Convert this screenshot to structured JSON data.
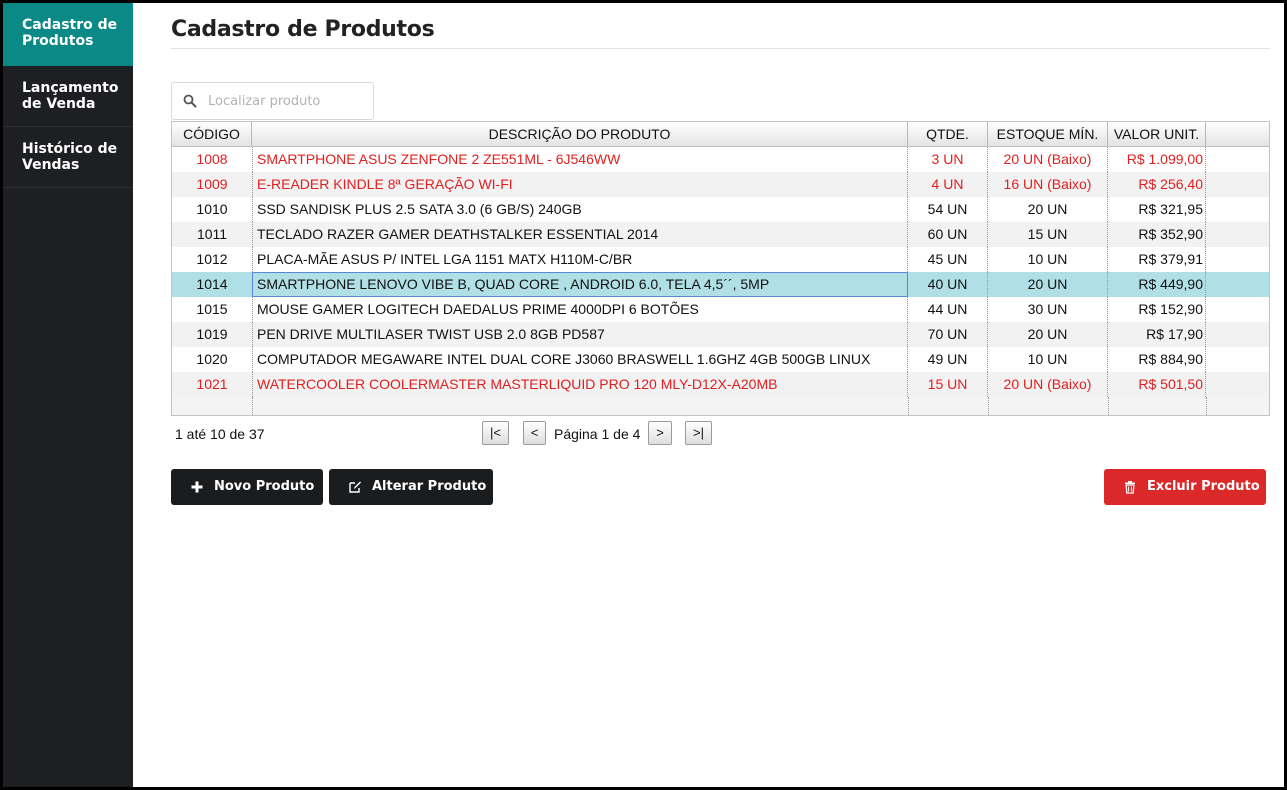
{
  "sidebar": {
    "items": [
      {
        "label_line1": "Cadastro de",
        "label_line2": "Produtos",
        "active": true
      },
      {
        "label_line1": "Lançamento",
        "label_line2": "de Venda",
        "active": false
      },
      {
        "label_line1": "Histórico de",
        "label_line2": "Vendas",
        "active": false
      }
    ]
  },
  "page": {
    "title": "Cadastro de Produtos"
  },
  "search": {
    "placeholder": "Localizar produto",
    "value": ""
  },
  "table": {
    "headers": [
      "CÓDIGO",
      "DESCRIÇÃO DO PRODUTO",
      "QTDE.",
      "ESTOQUE MÍN.",
      "VALOR UNIT."
    ],
    "rows": [
      {
        "code": "1008",
        "desc": "SMARTPHONE ASUS ZENFONE 2 ZE551ML - 6J546WW",
        "qty": "3 UN",
        "min": "20 UN (Baixo)",
        "value": "R$ 1.099,00",
        "low": true
      },
      {
        "code": "1009",
        "desc": "E-READER KINDLE 8ª GERAÇÃO WI-FI",
        "qty": "4 UN",
        "min": "16 UN (Baixo)",
        "value": "R$ 256,40",
        "low": true
      },
      {
        "code": "1010",
        "desc": "SSD SANDISK PLUS 2.5 SATA 3.0 (6 GB/S) 240GB",
        "qty": "54 UN",
        "min": "20 UN",
        "value": "R$ 321,95",
        "low": false
      },
      {
        "code": "1011",
        "desc": "TECLADO RAZER GAMER DEATHSTALKER ESSENTIAL 2014",
        "qty": "60 UN",
        "min": "15 UN",
        "value": "R$ 352,90",
        "low": false
      },
      {
        "code": "1012",
        "desc": "PLACA-MÃE ASUS P/ INTEL LGA 1151 MATX H110M-C/BR",
        "qty": "45 UN",
        "min": "10 UN",
        "value": "R$ 379,91",
        "low": false
      },
      {
        "code": "1014",
        "desc": "SMARTPHONE LENOVO VIBE B, QUAD CORE , ANDROID 6.0, TELA 4,5´´, 5MP",
        "qty": "40 UN",
        "min": "20 UN",
        "value": "R$ 449,90",
        "low": false,
        "selected": true
      },
      {
        "code": "1015",
        "desc": "MOUSE GAMER LOGITECH DAEDALUS PRIME 4000DPI 6 BOTÕES",
        "qty": "44 UN",
        "min": "30 UN",
        "value": "R$ 152,90",
        "low": false
      },
      {
        "code": "1019",
        "desc": "PEN DRIVE MULTILASER TWIST USB 2.0 8GB PD587",
        "qty": "70 UN",
        "min": "20 UN",
        "value": "R$ 17,90",
        "low": false
      },
      {
        "code": "1020",
        "desc": "COMPUTADOR MEGAWARE INTEL DUAL CORE J3060 BRASWELL 1.6GHZ 4GB 500GB LINUX",
        "qty": "49 UN",
        "min": "10 UN",
        "value": "R$ 884,90",
        "low": false
      },
      {
        "code": "1021",
        "desc": "WATERCOOLER COOLERMASTER MASTERLIQUID PRO 120 MLY-D12X-A20MB",
        "qty": "15 UN",
        "min": "20 UN (Baixo)",
        "value": "R$ 501,50",
        "low": true
      }
    ]
  },
  "pager": {
    "info": "1 até 10 de 37",
    "first": "|<",
    "prev": "<",
    "label": "Página 1 de 4",
    "next": ">",
    "last": ">|"
  },
  "actions": {
    "new_label": "Novo Produto",
    "edit_label": "Alterar Produto",
    "delete_label": "Excluir Produto"
  },
  "colors": {
    "sidebar_bg": "#1e1f22",
    "sidebar_active": "#0b8987",
    "low_stock_text": "#e02020",
    "selected_row": "#b0e0e6",
    "danger": "#db2828"
  },
  "icons": {
    "search": "search-icon",
    "new": "plus-icon",
    "edit": "edit-icon",
    "delete": "trash-icon"
  }
}
